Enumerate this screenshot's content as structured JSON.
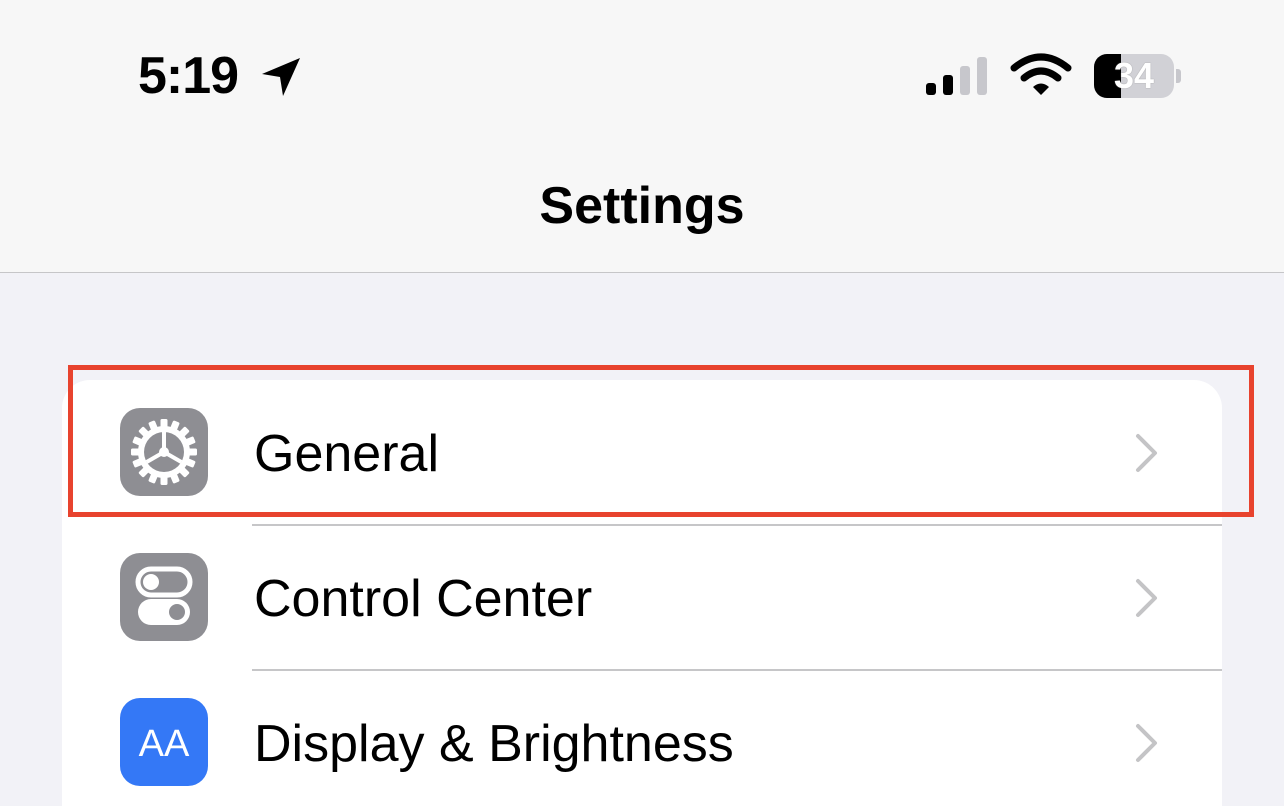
{
  "status_bar": {
    "time": "5:19",
    "location_icon": "location-arrow-icon",
    "signal_icon": "cellular-signal-icon",
    "wifi_icon": "wifi-icon",
    "battery_percent": "34",
    "battery_level": 0.34
  },
  "nav": {
    "title": "Settings"
  },
  "settings_rows": [
    {
      "label": "General",
      "icon": "gear-icon",
      "icon_color": "#8e8e93"
    },
    {
      "label": "Control Center",
      "icon": "toggles-icon",
      "icon_color": "#8e8e93"
    },
    {
      "label": "Display & Brightness",
      "icon": "text-size-icon",
      "icon_color": "#3478f6",
      "icon_text": "AA"
    }
  ],
  "highlight": {
    "color": "#e8432e",
    "target": "General"
  }
}
